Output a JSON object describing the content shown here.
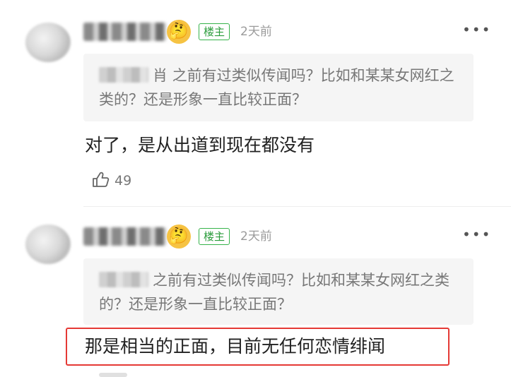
{
  "comments": [
    {
      "badge": "楼主",
      "time": "2天前",
      "more": "•••",
      "quote_visible_suffix": "肖",
      "quote_text": "之前有过类似传闻吗？比如和某某女网红之类的？还是形象一直比较正面？",
      "body": "对了，是从出道到现在都没有",
      "likes": "49",
      "emoji": "🤔"
    },
    {
      "badge": "楼主",
      "time": "2天前",
      "more": "•••",
      "quote_text": "之前有过类似传闻吗？比如和某某女网红之类的？还是形象一直比较正面？",
      "body": "那是相当的正面，目前无任何恋情绯闻",
      "emoji": "🤔"
    }
  ],
  "colors": {
    "badge_green": "#2a9b3b",
    "highlight_red": "#e53935"
  }
}
